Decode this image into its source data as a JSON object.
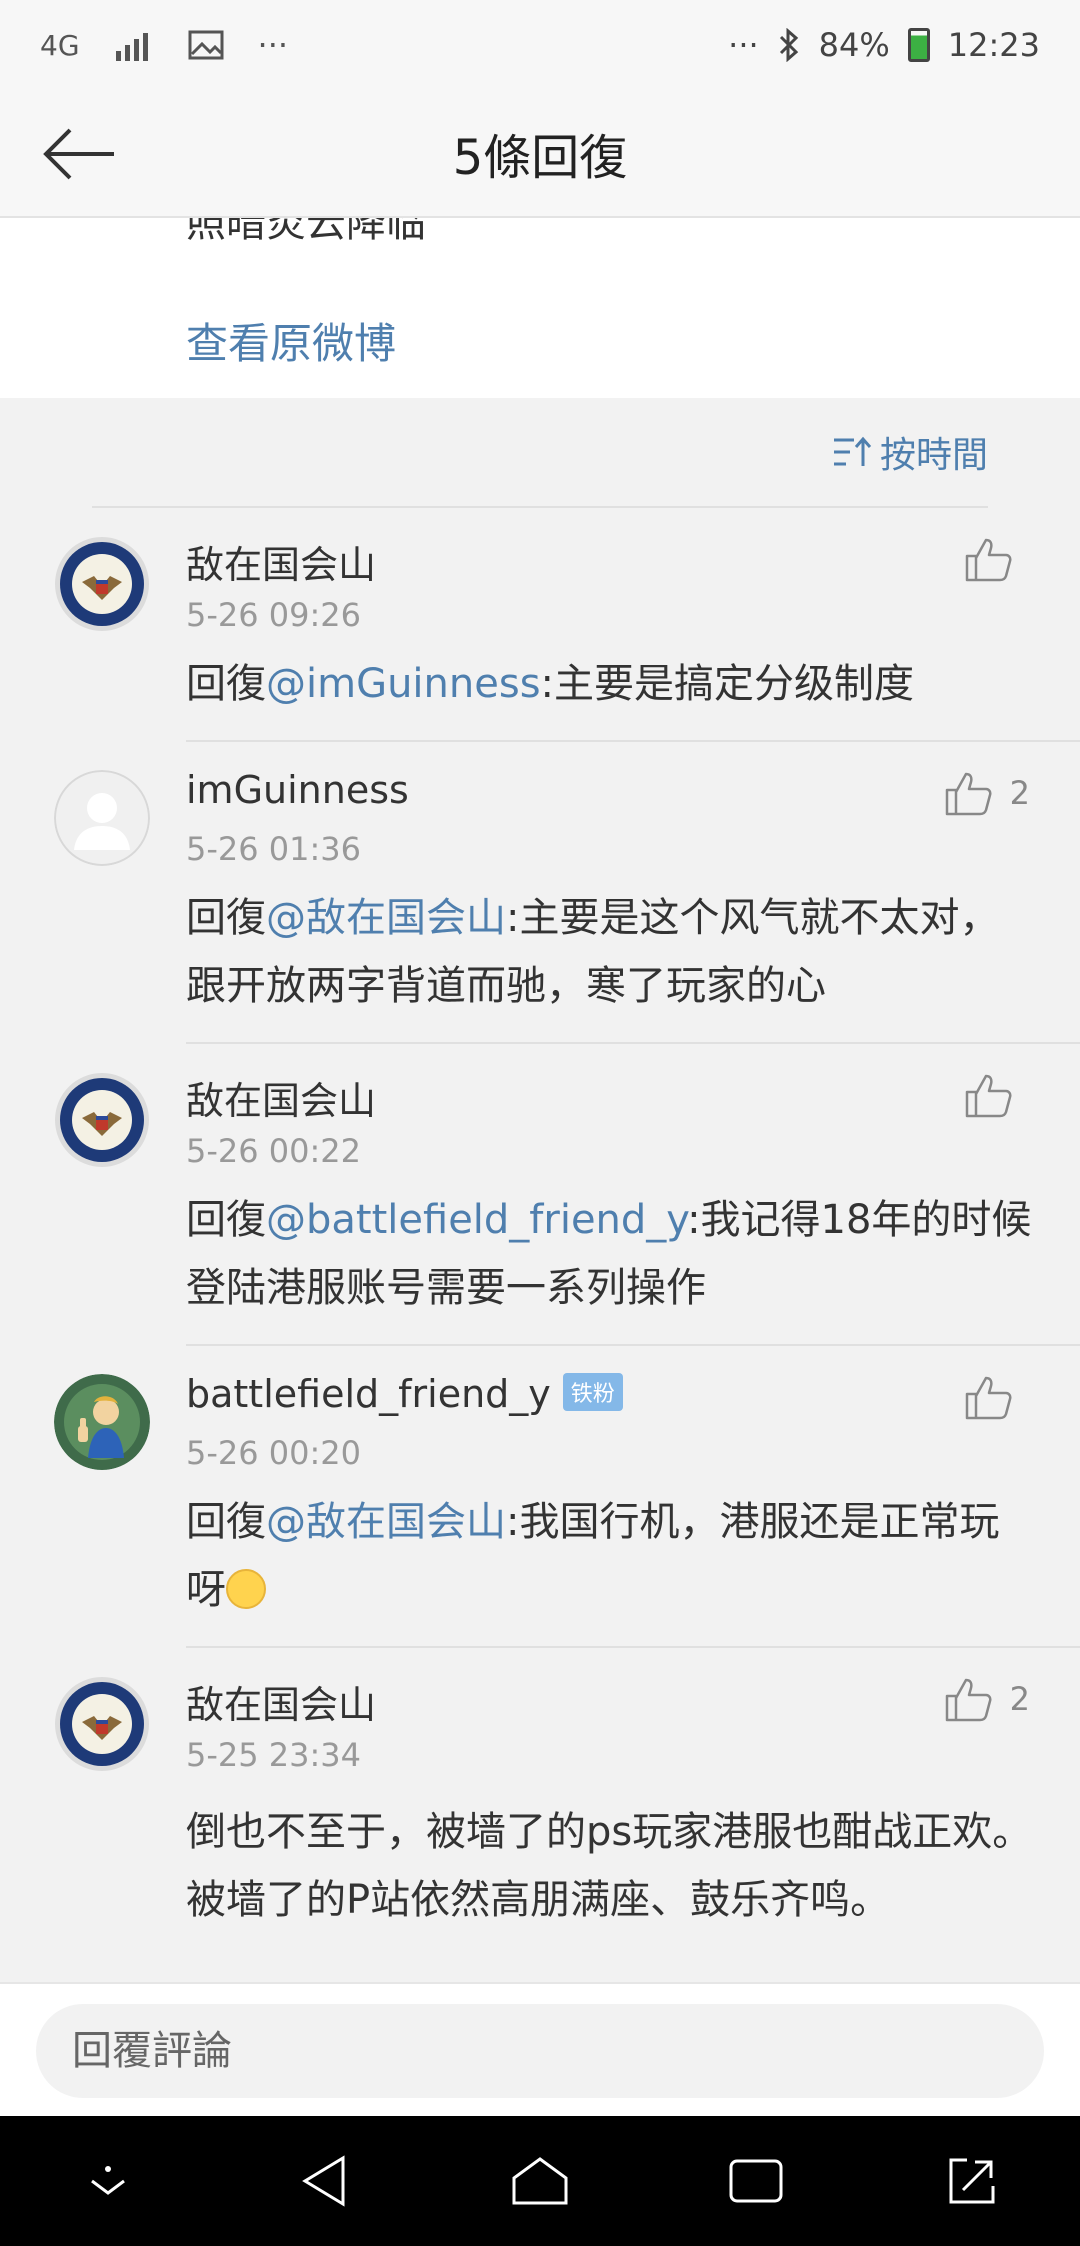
{
  "status_bar": {
    "network": "4G",
    "dots_left": "···",
    "dots_right": "···",
    "battery": "84%",
    "time": "12:23"
  },
  "header": {
    "title": "5條回復"
  },
  "original_post": {
    "cut_text": "照暗炎云降临",
    "view_original": "查看原微博"
  },
  "sort": {
    "label": "按時間"
  },
  "comments": [
    {
      "username": "敌在国会山",
      "time": "5-26 09:26",
      "prefix": "回復",
      "mention": "@imGuinness",
      "text": ":主要是搞定分级制度",
      "likes": ""
    },
    {
      "username": "imGuinness",
      "time": "5-26 01:36",
      "prefix": "回復",
      "mention": "@敌在国会山",
      "text": ":主要是这个风气就不太对，跟开放两字背道而驰，寒了玩家的心",
      "likes": "2"
    },
    {
      "username": "敌在国会山",
      "time": "5-26 00:22",
      "prefix": "回復",
      "mention": "@battlefield_friend_y",
      "text": ":我记得18年的时候登陆港服账号需要一系列操作",
      "likes": ""
    },
    {
      "username": "battlefield_friend_y",
      "badge": "铁粉",
      "time": "5-26 00:20",
      "prefix": "回復",
      "mention": "@敌在国会山",
      "text": ":我国行机，港服还是正常玩呀",
      "likes": ""
    },
    {
      "username": "敌在国会山",
      "time": "5-25 23:34",
      "text": "倒也不至于，被墙了的ps玩家港服也酣战正欢。被墙了的P站依然高朋满座、鼓乐齐鸣。",
      "likes": "2"
    }
  ],
  "reply_bar": {
    "placeholder": "回覆評論"
  },
  "colors": {
    "link": "#4f7fae",
    "background": "#f2f2f2",
    "badge": "#84b8e8"
  }
}
